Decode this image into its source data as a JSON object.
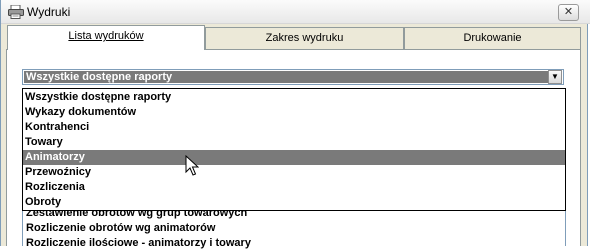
{
  "window": {
    "title": "Wydruki",
    "close_label": "✕"
  },
  "tabs": [
    {
      "label": "Lista wydruków",
      "active": true
    },
    {
      "label": "Zakres wydruku",
      "active": false
    },
    {
      "label": "Drukowanie",
      "active": false
    }
  ],
  "combo": {
    "selected_value": "Wszystkie dostępne raporty",
    "arrow": "▼"
  },
  "dropdown": {
    "items": [
      "Wszystkie dostępne raporty",
      "Wykazy dokumentów",
      "Kontrahenci",
      "Towary",
      "Animatorzy",
      "Przewoźnicy",
      "Rozliczenia",
      "Obroty"
    ],
    "highlighted": "Animatorzy"
  },
  "report_list": {
    "rows": [
      "Zestawienie obrotów wg grup towarowych",
      "Rozliczenie obrotów wg animatorów",
      "Rozliczenie ilościowe - animatorzy i towary"
    ]
  },
  "colors": {
    "selection": "#7a7a7a",
    "border": "#7f9db9",
    "tab_border": "#919b9c"
  },
  "icons": {
    "title": "printer-icon",
    "cursor": "mouse-pointer-icon"
  }
}
